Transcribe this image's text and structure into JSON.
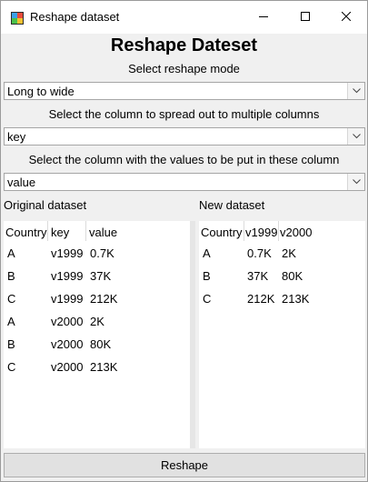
{
  "window": {
    "title": "Reshape dataset",
    "icon": "app-grid-icon",
    "controls": [
      "minimize-icon",
      "maximize-icon",
      "close-icon"
    ]
  },
  "heading": "Reshape Dateset",
  "mode": {
    "label": "Select reshape mode",
    "value": "Long to wide"
  },
  "spread_column": {
    "label": "Select the column to spread out to multiple columns",
    "value": "key"
  },
  "value_column": {
    "label": "Select the column with the values to be put in these column",
    "value": "value"
  },
  "original": {
    "title": "Original dataset",
    "headers": [
      "Country",
      "key",
      "value"
    ],
    "rows": [
      [
        "A",
        "v1999",
        "0.7K"
      ],
      [
        "B",
        "v1999",
        "37K"
      ],
      [
        "C",
        "v1999",
        "212K"
      ],
      [
        "A",
        "v2000",
        "2K"
      ],
      [
        "B",
        "v2000",
        "80K"
      ],
      [
        "C",
        "v2000",
        "213K"
      ]
    ]
  },
  "new": {
    "title": "New dataset",
    "headers": [
      "Country",
      "v1999",
      "v2000"
    ],
    "rows": [
      [
        "A",
        "0.7K",
        "2K"
      ],
      [
        "B",
        "37K",
        "80K"
      ],
      [
        "C",
        "212K",
        "213K"
      ]
    ]
  },
  "actions": {
    "reshape_label": "Reshape"
  },
  "colors": {
    "window_bg": "#f0f0f0",
    "button_bg": "#e1e1e1",
    "border": "#a6a6a6"
  }
}
